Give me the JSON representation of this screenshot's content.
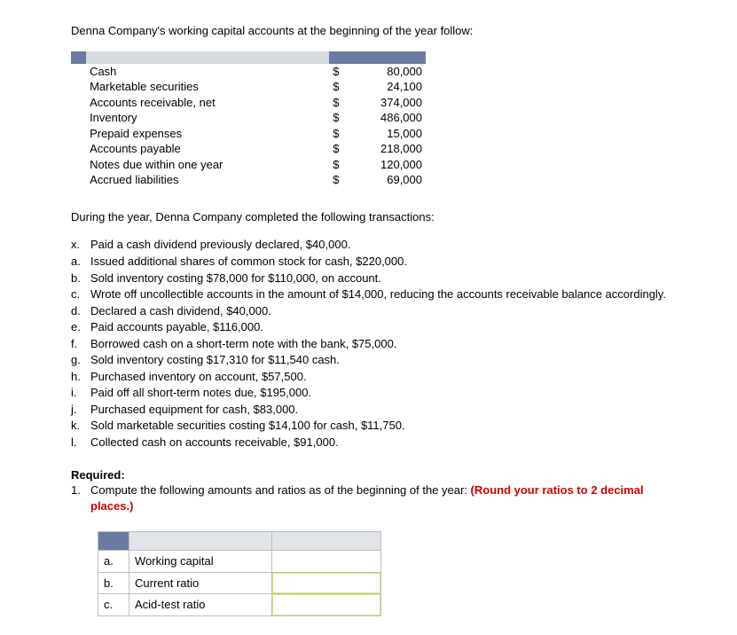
{
  "intro": "Denna Company's working capital accounts at the beginning of the year follow:",
  "accounts": [
    {
      "label": "Cash",
      "curr": "$",
      "val": "80,000"
    },
    {
      "label": "Marketable securities",
      "curr": "$",
      "val": "24,100"
    },
    {
      "label": "Accounts receivable, net",
      "curr": "$",
      "val": "374,000"
    },
    {
      "label": "Inventory",
      "curr": "$",
      "val": "486,000"
    },
    {
      "label": "Prepaid expenses",
      "curr": "$",
      "val": "15,000"
    },
    {
      "label": "Accounts payable",
      "curr": "$",
      "val": "218,000"
    },
    {
      "label": "Notes due within one year",
      "curr": "$",
      "val": "120,000"
    },
    {
      "label": "Accrued liabilities",
      "curr": "$",
      "val": "69,000"
    }
  ],
  "mid": "During the year, Denna Company completed the following transactions:",
  "tx": [
    {
      "b": "x.",
      "t": "Paid a cash dividend previously declared, $40,000."
    },
    {
      "b": "a.",
      "t": "Issued additional shares of common stock for cash, $220,000."
    },
    {
      "b": "b.",
      "t": "Sold inventory costing $78,000 for $110,000, on account."
    },
    {
      "b": "c.",
      "t": "Wrote off uncollectible accounts in the amount of $14,000, reducing the accounts receivable balance accordingly."
    },
    {
      "b": "d.",
      "t": "Declared a cash dividend, $40,000."
    },
    {
      "b": "e.",
      "t": "Paid accounts payable, $116,000."
    },
    {
      "b": "f.",
      "t": "Borrowed cash on a short-term note with the bank, $75,000."
    },
    {
      "b": "g.",
      "t": "Sold inventory costing $17,310 for $11,540 cash."
    },
    {
      "b": "h.",
      "t": "Purchased inventory on account, $57,500."
    },
    {
      "b": "i.",
      "t": "Paid off all short-term notes due, $195,000."
    },
    {
      "b": "j.",
      "t": "Purchased equipment for cash, $83,000."
    },
    {
      "b": "k.",
      "t": "Sold marketable securities costing $14,100 for cash, $11,750."
    },
    {
      "b": "l.",
      "t": "Collected cash on accounts receivable, $91,000."
    }
  ],
  "required_heading": "Required:",
  "required": {
    "b": "1.",
    "t_plain": "Compute the following amounts and ratios as of the beginning of the year: ",
    "t_red": "(Round your ratios to 2 decimal places.)"
  },
  "answers": [
    {
      "letter": "a.",
      "label": "Working capital"
    },
    {
      "letter": "b.",
      "label": "Current ratio"
    },
    {
      "letter": "c.",
      "label": "Acid-test ratio"
    }
  ]
}
